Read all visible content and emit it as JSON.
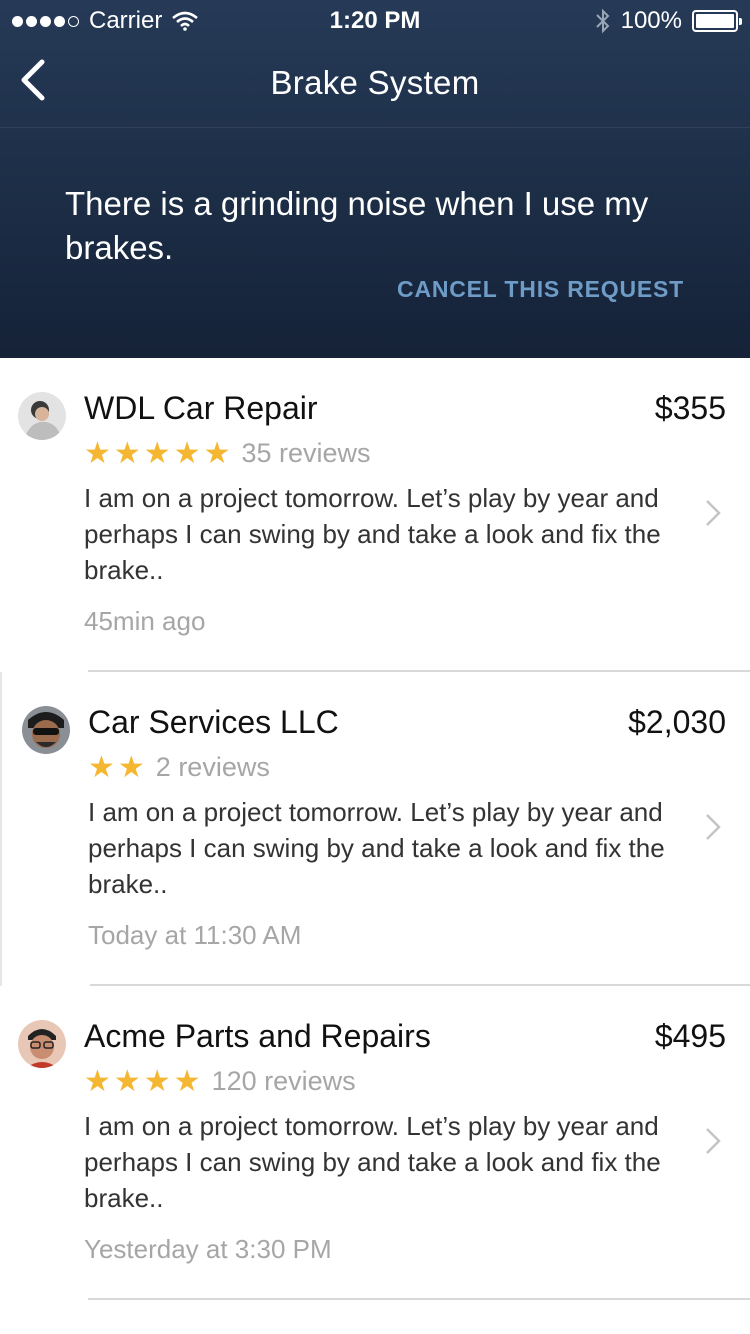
{
  "status": {
    "carrier": "Carrier",
    "time": "1:20 PM",
    "battery": "100%"
  },
  "nav": {
    "title": "Brake System"
  },
  "request": {
    "text": "There is a grinding noise when I use my brakes.",
    "cancel": "CANCEL THIS REQUEST"
  },
  "colors": {
    "star": "#f5b731",
    "header_top": "#263a57",
    "header_bottom": "#152238",
    "link": "#6e9cc7"
  },
  "quotes": [
    {
      "name": "WDL Car Repair",
      "price": "$355",
      "stars": "★★★★★",
      "reviews": "35 reviews",
      "message": "I am on a project tomorrow. Let’s play by year and perhaps I can swing by and take a look and fix the brake..",
      "time": "45min ago"
    },
    {
      "name": "Car Services LLC",
      "price": "$2,030",
      "stars": "★★",
      "reviews": "2 reviews",
      "message": "I am on a project tomorrow. Let’s play by year and perhaps I can swing by and take a look and fix the brake..",
      "time": "Today at 11:30 AM"
    },
    {
      "name": "Acme Parts and Repairs",
      "price": "$495",
      "stars": "★★★★",
      "reviews": "120 reviews",
      "message": "I am on a project tomorrow. Let’s play by year and perhaps I can swing by and take a look and fix the brake..",
      "time": "Yesterday at 3:30 PM"
    }
  ]
}
